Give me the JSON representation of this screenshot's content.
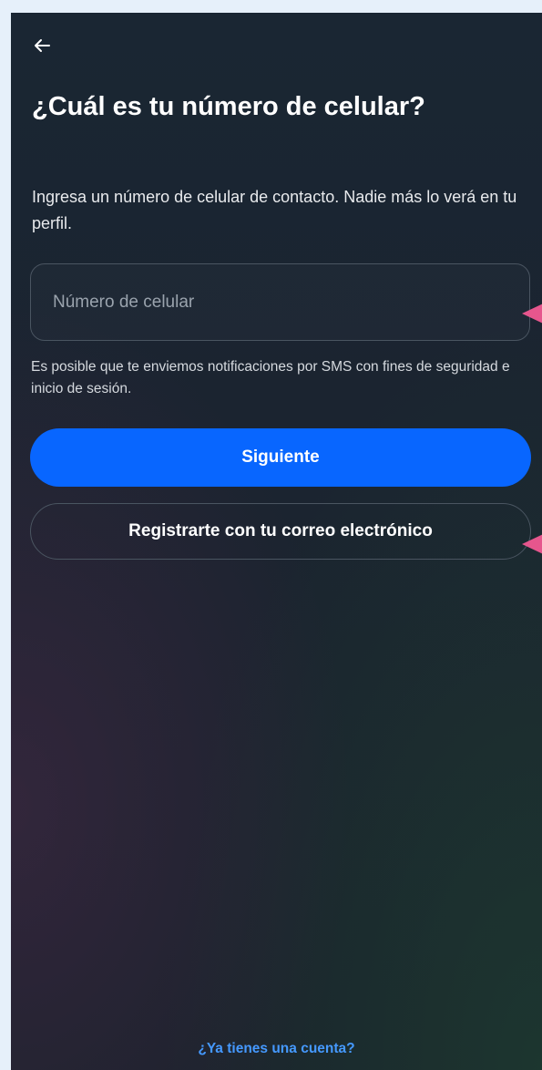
{
  "screen": {
    "title": "¿Cuál es tu número de celular?",
    "subtitle": "Ingresa un número de celular de contacto. Nadie más lo verá en tu perfil."
  },
  "phone_input": {
    "placeholder": "Número de celular",
    "value": ""
  },
  "sms_note": "Es posible que te enviemos notificaciones por SMS con fines de seguridad e inicio de sesión.",
  "buttons": {
    "next_label": "Siguiente",
    "email_signup_label": "Registrarte con tu correo electrónico"
  },
  "footer": {
    "login_link": "¿Ya tienes una cuenta?"
  },
  "icons": {
    "back": "arrow-left-icon",
    "annotations": "pink-pointer-arrow"
  },
  "colors": {
    "background": "#1a2430",
    "primary_button": "#0866ff",
    "link": "#4599ff",
    "annotation_pointer": "#e6568d",
    "outer_background": "#e6f0fa"
  }
}
